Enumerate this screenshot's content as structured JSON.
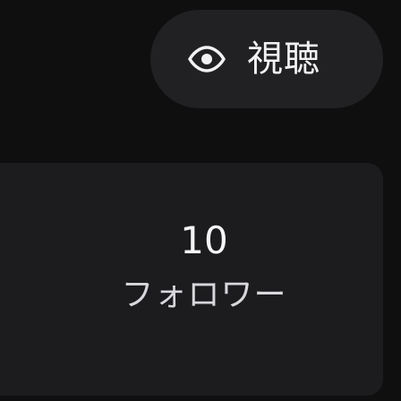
{
  "watch_button": {
    "icon": "eye-icon",
    "label": "視聴"
  },
  "follower_stat": {
    "count": "10",
    "label": "フォロワー"
  },
  "colors": {
    "background": "#0f0f10",
    "pill": "#212124",
    "card": "#1c1c1f",
    "text": "#f6f6f7"
  }
}
